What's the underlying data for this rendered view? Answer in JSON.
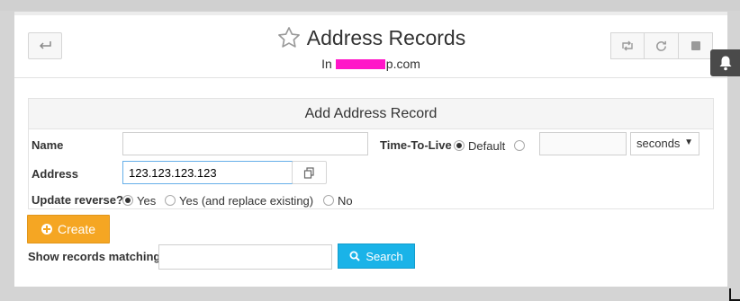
{
  "header": {
    "title": "Address Records",
    "subtitle_prefix": "In",
    "subtitle_suffix": "p.com"
  },
  "icons": {
    "back": "back-arrow-icon",
    "favorite": "star-icon",
    "toolbar": [
      "retweet-icon",
      "refresh-icon",
      "stop-icon"
    ],
    "notification": "bell-icon"
  },
  "form": {
    "heading": "Add Address Record",
    "name_label": "Name",
    "name_value": "",
    "ttl_label": "Time-To-Live",
    "ttl_default_label": "Default",
    "ttl_selected": "Default",
    "ttl_custom_value": "",
    "ttl_unit": "seconds",
    "address_label": "Address",
    "address_value": "123.123.123.123",
    "update_reverse_label": "Update reverse?",
    "reverse_options": [
      "Yes",
      "Yes (and replace existing)",
      "No"
    ],
    "reverse_selected": "Yes"
  },
  "actions": {
    "create_label": "Create",
    "show_matching_label": "Show records matching:",
    "search_value": "",
    "search_label": "Search"
  },
  "colors": {
    "create": "#f5a623",
    "search": "#1ab3e8",
    "redaction": "#ff16c8"
  }
}
